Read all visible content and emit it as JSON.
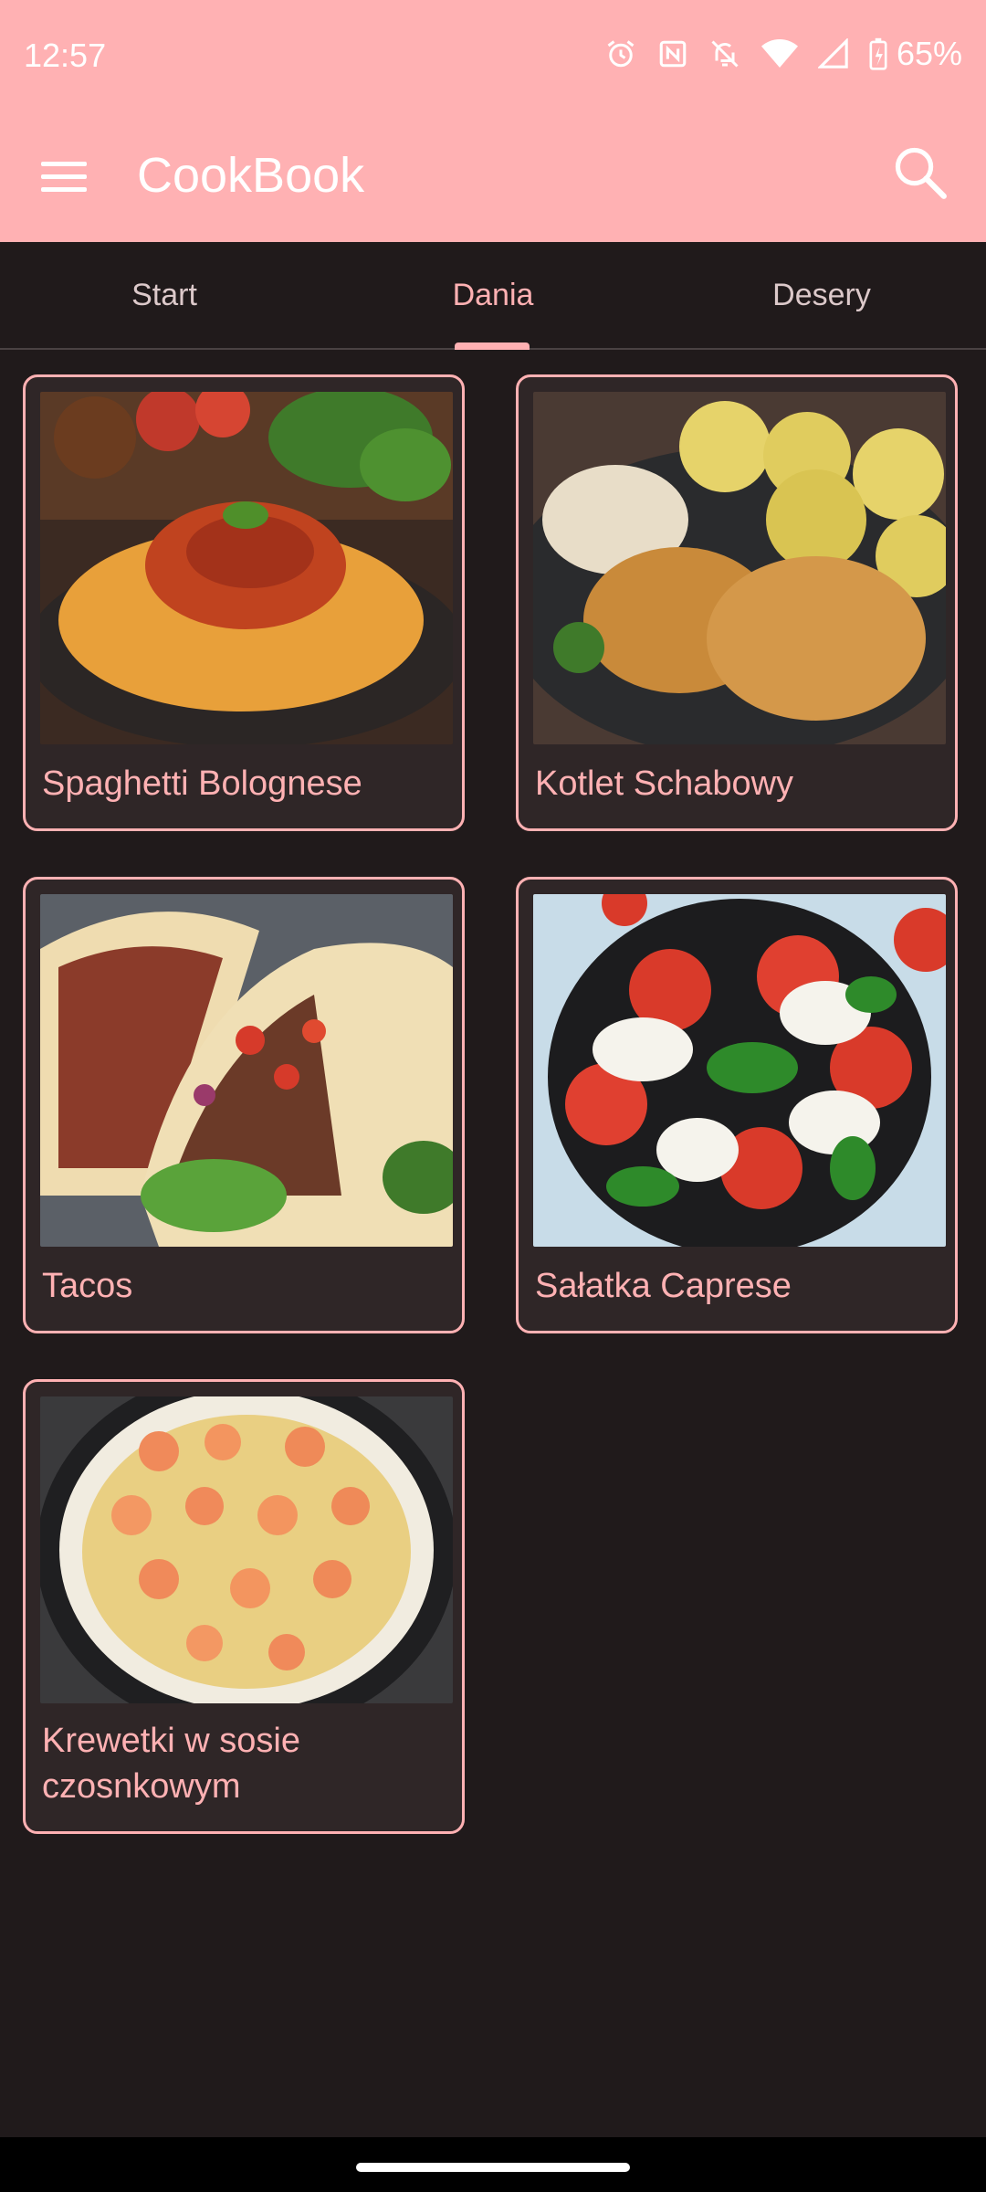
{
  "status_bar": {
    "time": "12:57",
    "battery": "65%",
    "icons": [
      "alarm-icon",
      "nfc-icon",
      "bell-off-icon",
      "wifi-icon",
      "signal-icon",
      "battery-icon"
    ]
  },
  "app_bar": {
    "title": "CookBook",
    "menu_icon": "hamburger-menu-icon",
    "search_icon": "search-icon"
  },
  "tabs": [
    {
      "label": "Start",
      "active": false
    },
    {
      "label": "Dania",
      "active": true
    },
    {
      "label": "Desery",
      "active": false
    }
  ],
  "recipes": [
    {
      "title": "Spaghetti Bolognese",
      "image": "spaghetti-photo"
    },
    {
      "title": "Kotlet Schabowy",
      "image": "pork-cutlet-photo"
    },
    {
      "title": "Tacos",
      "image": "tacos-photo"
    },
    {
      "title": "Sałatka Caprese",
      "image": "caprese-salad-photo"
    },
    {
      "title": "Krewetki w sosie czosnkowym",
      "image": "garlic-shrimp-photo"
    }
  ],
  "colors": {
    "primary": "#ffb1b3",
    "background": "#201a1b",
    "card": "#2f2627",
    "tab_inactive": "#dcc9ca"
  }
}
